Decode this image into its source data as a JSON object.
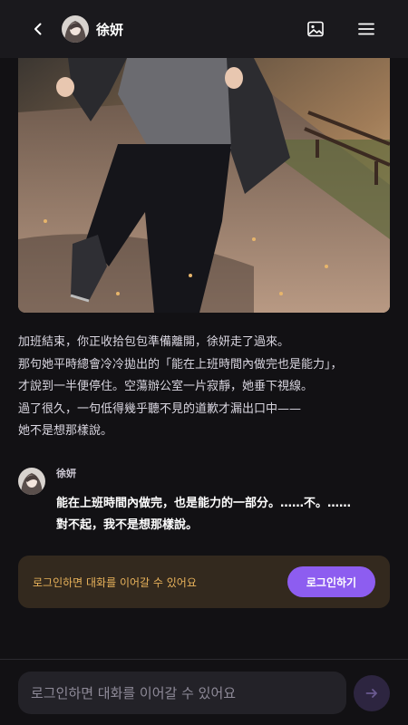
{
  "header": {
    "title": "徐妍",
    "back_icon": "chevron-left-icon",
    "gallery_icon": "image-icon",
    "menu_icon": "hamburger-menu-icon"
  },
  "narration": [
    "加班結束，你正收拾包包準備離開，徐妍走了過來。",
    "那句她平時總會冷冷拋出的「能在上班時間內做完也是能力」，",
    "才說到一半便停住。空蕩辦公室一片寂靜，她垂下視線。",
    "過了很久，一句低得幾乎聽不見的道歉才漏出口中——",
    "她不是想那樣說。"
  ],
  "message": {
    "name": "徐妍",
    "lines": [
      "能在上班時間內做完，也是能力的一部分。……不。……",
      "對不起，我不是想那樣說。"
    ]
  },
  "banner": {
    "text": "로그인하면 대화를 이어갈 수 있어요",
    "button": "로그인하기"
  },
  "composer": {
    "placeholder": "로그인하면 대화를 이어갈 수 있어요",
    "send_icon": "arrow-right-icon"
  },
  "colors": {
    "accent": "#8d5df0",
    "banner_bg": "#33291e",
    "banner_text": "#e8b25b",
    "background": "#121114"
  }
}
